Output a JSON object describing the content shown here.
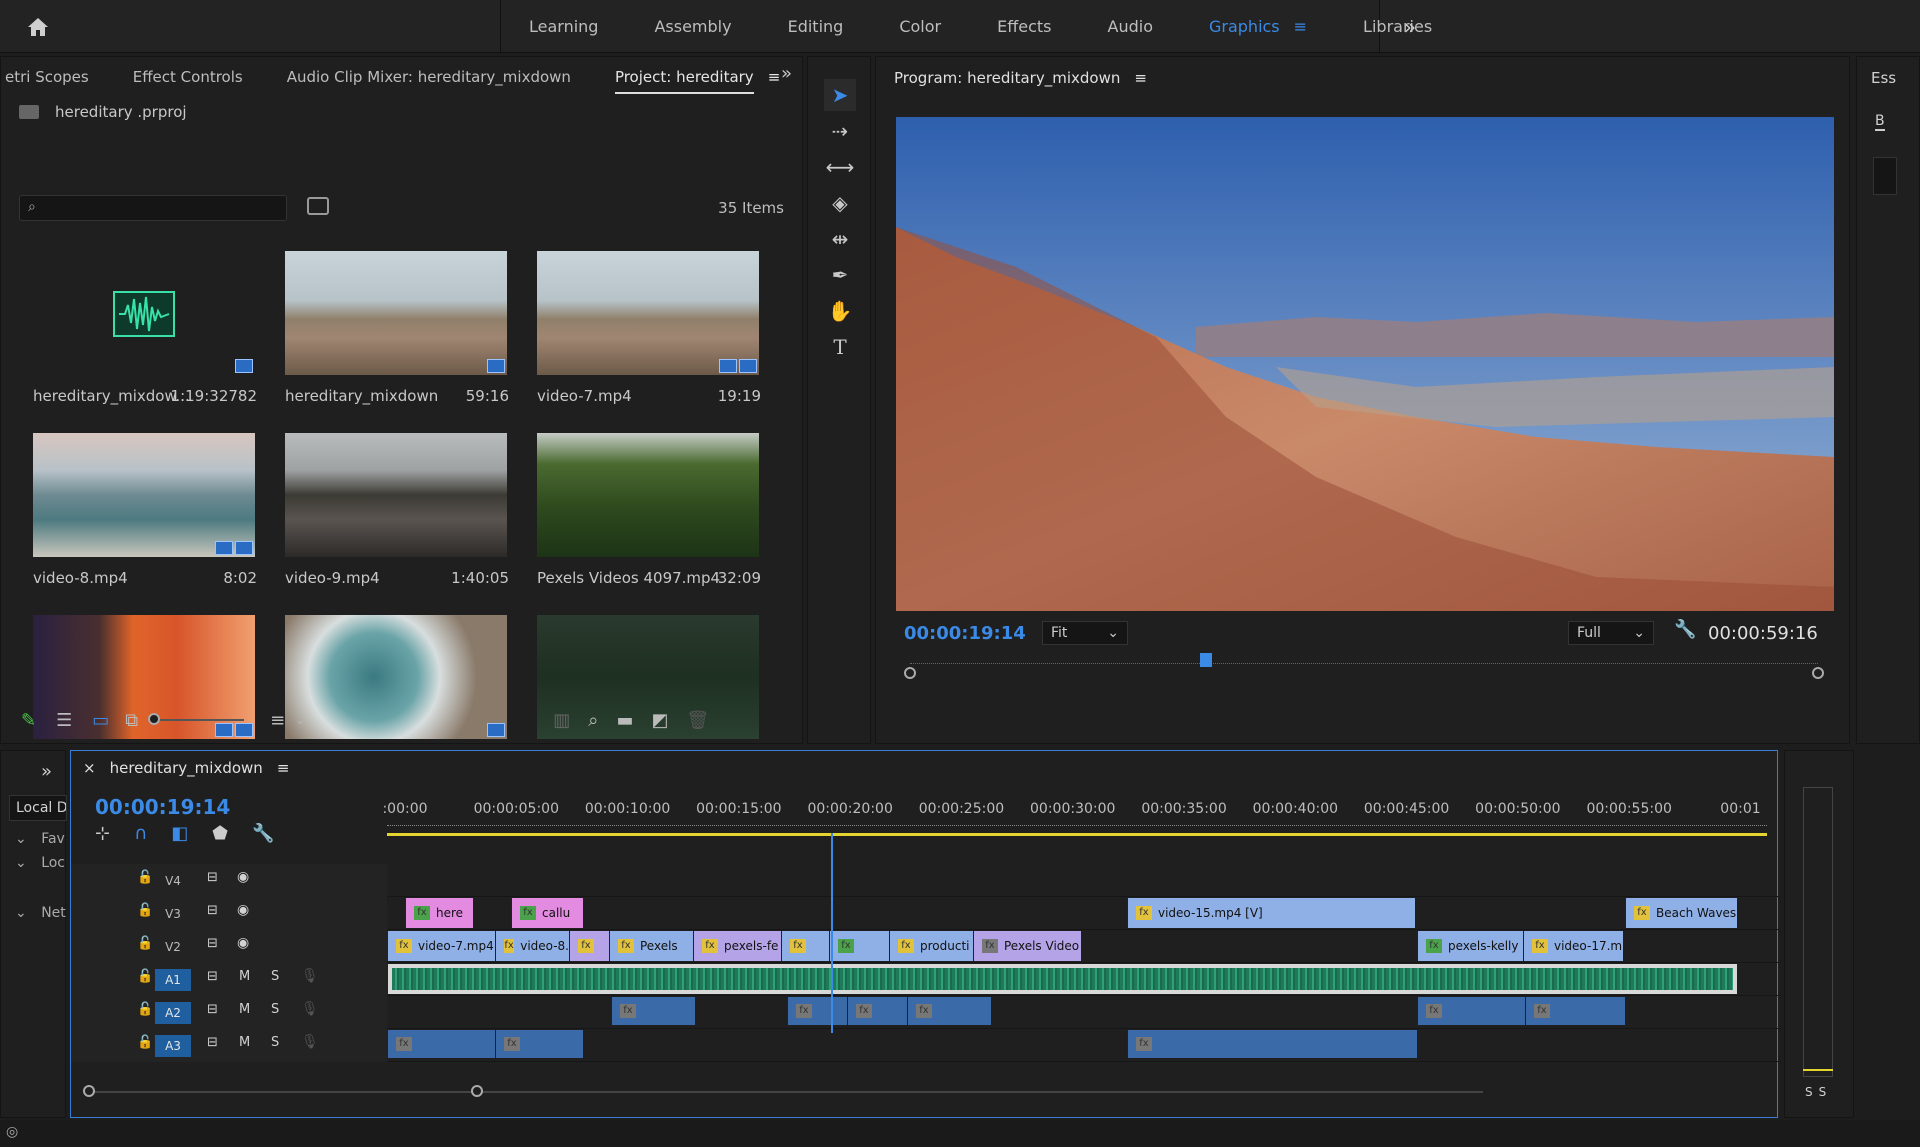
{
  "topbar": {
    "tabs": [
      "Learning",
      "Assembly",
      "Editing",
      "Color",
      "Effects",
      "Audio",
      "Graphics",
      "Libraries"
    ],
    "active_tab": "Graphics"
  },
  "project_panel": {
    "tabs": [
      "etri Scopes",
      "Effect Controls",
      "Audio Clip Mixer: hereditary_mixdown",
      "Project: hereditary"
    ],
    "active_tab": "Project: hereditary",
    "file": "hereditary .prproj",
    "items_count": "35 Items",
    "clips": [
      {
        "name": "hereditary_mixdow...",
        "duration": "1:19:32782"
      },
      {
        "name": "hereditary_mixdown",
        "duration": "59:16"
      },
      {
        "name": "video-7.mp4",
        "duration": "19:19"
      },
      {
        "name": "video-8.mp4",
        "duration": "8:02"
      },
      {
        "name": "video-9.mp4",
        "duration": "1:40:05"
      },
      {
        "name": "Pexels Videos 4097.mp4",
        "duration": "32:09"
      }
    ]
  },
  "program_monitor": {
    "title": "Program: hereditary_mixdown",
    "timecode_current": "00:00:19:14",
    "timecode_duration": "00:00:59:16",
    "zoom": "Fit",
    "resolution": "Full"
  },
  "essential": {
    "tab": "Ess",
    "label": "B"
  },
  "left_strip": {
    "label": "Local D",
    "items": [
      "Fav",
      "Loc",
      "Net"
    ]
  },
  "timeline": {
    "sequence": "hereditary_mixdown",
    "timecode": "00:00:19:14",
    "ruler": [
      ":00:00",
      "00:00:05:00",
      "00:00:10:00",
      "00:00:15:00",
      "00:00:20:00",
      "00:00:25:00",
      "00:00:30:00",
      "00:00:35:00",
      "00:00:40:00",
      "00:00:45:00",
      "00:00:50:00",
      "00:00:55:00",
      "00:01"
    ],
    "tracks": [
      "V4",
      "V3",
      "V2",
      "A1",
      "A2",
      "A3"
    ],
    "v3_clips": [
      "here",
      "callu",
      "video-15.mp4 [V]",
      "Beach Waves"
    ],
    "v2_clips": [
      "video-7.mp4",
      "video-8.",
      "Pexels",
      "pexels-fe",
      "producti",
      "Pexels Video",
      "pexels-kelly",
      "video-17.m"
    ],
    "track_buttons": {
      "mute": "M",
      "solo": "S"
    }
  },
  "meter": {
    "labels": [
      "S",
      "S"
    ]
  }
}
